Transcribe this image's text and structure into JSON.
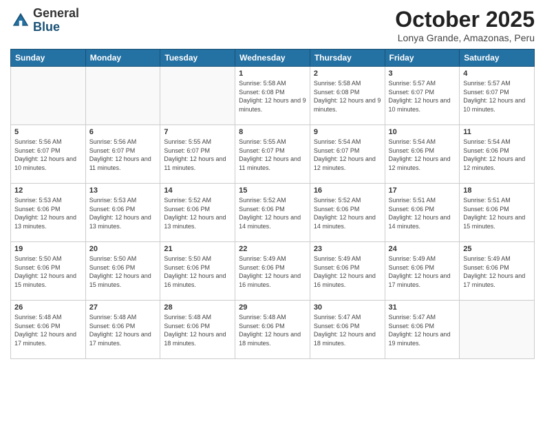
{
  "logo": {
    "general": "General",
    "blue": "Blue"
  },
  "header": {
    "month_year": "October 2025",
    "location": "Lonya Grande, Amazonas, Peru"
  },
  "weekdays": [
    "Sunday",
    "Monday",
    "Tuesday",
    "Wednesday",
    "Thursday",
    "Friday",
    "Saturday"
  ],
  "weeks": [
    [
      {
        "day": "",
        "empty": true
      },
      {
        "day": "",
        "empty": true
      },
      {
        "day": "",
        "empty": true
      },
      {
        "day": "1",
        "sunrise": "5:58 AM",
        "sunset": "6:08 PM",
        "daylight": "12 hours and 9 minutes."
      },
      {
        "day": "2",
        "sunrise": "5:58 AM",
        "sunset": "6:08 PM",
        "daylight": "12 hours and 9 minutes."
      },
      {
        "day": "3",
        "sunrise": "5:57 AM",
        "sunset": "6:07 PM",
        "daylight": "12 hours and 10 minutes."
      },
      {
        "day": "4",
        "sunrise": "5:57 AM",
        "sunset": "6:07 PM",
        "daylight": "12 hours and 10 minutes."
      }
    ],
    [
      {
        "day": "5",
        "sunrise": "5:56 AM",
        "sunset": "6:07 PM",
        "daylight": "12 hours and 10 minutes."
      },
      {
        "day": "6",
        "sunrise": "5:56 AM",
        "sunset": "6:07 PM",
        "daylight": "12 hours and 11 minutes."
      },
      {
        "day": "7",
        "sunrise": "5:55 AM",
        "sunset": "6:07 PM",
        "daylight": "12 hours and 11 minutes."
      },
      {
        "day": "8",
        "sunrise": "5:55 AM",
        "sunset": "6:07 PM",
        "daylight": "12 hours and 11 minutes."
      },
      {
        "day": "9",
        "sunrise": "5:54 AM",
        "sunset": "6:07 PM",
        "daylight": "12 hours and 12 minutes."
      },
      {
        "day": "10",
        "sunrise": "5:54 AM",
        "sunset": "6:06 PM",
        "daylight": "12 hours and 12 minutes."
      },
      {
        "day": "11",
        "sunrise": "5:54 AM",
        "sunset": "6:06 PM",
        "daylight": "12 hours and 12 minutes."
      }
    ],
    [
      {
        "day": "12",
        "sunrise": "5:53 AM",
        "sunset": "6:06 PM",
        "daylight": "12 hours and 13 minutes."
      },
      {
        "day": "13",
        "sunrise": "5:53 AM",
        "sunset": "6:06 PM",
        "daylight": "12 hours and 13 minutes."
      },
      {
        "day": "14",
        "sunrise": "5:52 AM",
        "sunset": "6:06 PM",
        "daylight": "12 hours and 13 minutes."
      },
      {
        "day": "15",
        "sunrise": "5:52 AM",
        "sunset": "6:06 PM",
        "daylight": "12 hours and 14 minutes."
      },
      {
        "day": "16",
        "sunrise": "5:52 AM",
        "sunset": "6:06 PM",
        "daylight": "12 hours and 14 minutes."
      },
      {
        "day": "17",
        "sunrise": "5:51 AM",
        "sunset": "6:06 PM",
        "daylight": "12 hours and 14 minutes."
      },
      {
        "day": "18",
        "sunrise": "5:51 AM",
        "sunset": "6:06 PM",
        "daylight": "12 hours and 15 minutes."
      }
    ],
    [
      {
        "day": "19",
        "sunrise": "5:50 AM",
        "sunset": "6:06 PM",
        "daylight": "12 hours and 15 minutes."
      },
      {
        "day": "20",
        "sunrise": "5:50 AM",
        "sunset": "6:06 PM",
        "daylight": "12 hours and 15 minutes."
      },
      {
        "day": "21",
        "sunrise": "5:50 AM",
        "sunset": "6:06 PM",
        "daylight": "12 hours and 16 minutes."
      },
      {
        "day": "22",
        "sunrise": "5:49 AM",
        "sunset": "6:06 PM",
        "daylight": "12 hours and 16 minutes."
      },
      {
        "day": "23",
        "sunrise": "5:49 AM",
        "sunset": "6:06 PM",
        "daylight": "12 hours and 16 minutes."
      },
      {
        "day": "24",
        "sunrise": "5:49 AM",
        "sunset": "6:06 PM",
        "daylight": "12 hours and 17 minutes."
      },
      {
        "day": "25",
        "sunrise": "5:49 AM",
        "sunset": "6:06 PM",
        "daylight": "12 hours and 17 minutes."
      }
    ],
    [
      {
        "day": "26",
        "sunrise": "5:48 AM",
        "sunset": "6:06 PM",
        "daylight": "12 hours and 17 minutes."
      },
      {
        "day": "27",
        "sunrise": "5:48 AM",
        "sunset": "6:06 PM",
        "daylight": "12 hours and 17 minutes."
      },
      {
        "day": "28",
        "sunrise": "5:48 AM",
        "sunset": "6:06 PM",
        "daylight": "12 hours and 18 minutes."
      },
      {
        "day": "29",
        "sunrise": "5:48 AM",
        "sunset": "6:06 PM",
        "daylight": "12 hours and 18 minutes."
      },
      {
        "day": "30",
        "sunrise": "5:47 AM",
        "sunset": "6:06 PM",
        "daylight": "12 hours and 18 minutes."
      },
      {
        "day": "31",
        "sunrise": "5:47 AM",
        "sunset": "6:06 PM",
        "daylight": "12 hours and 19 minutes."
      },
      {
        "day": "",
        "empty": true
      }
    ]
  ]
}
